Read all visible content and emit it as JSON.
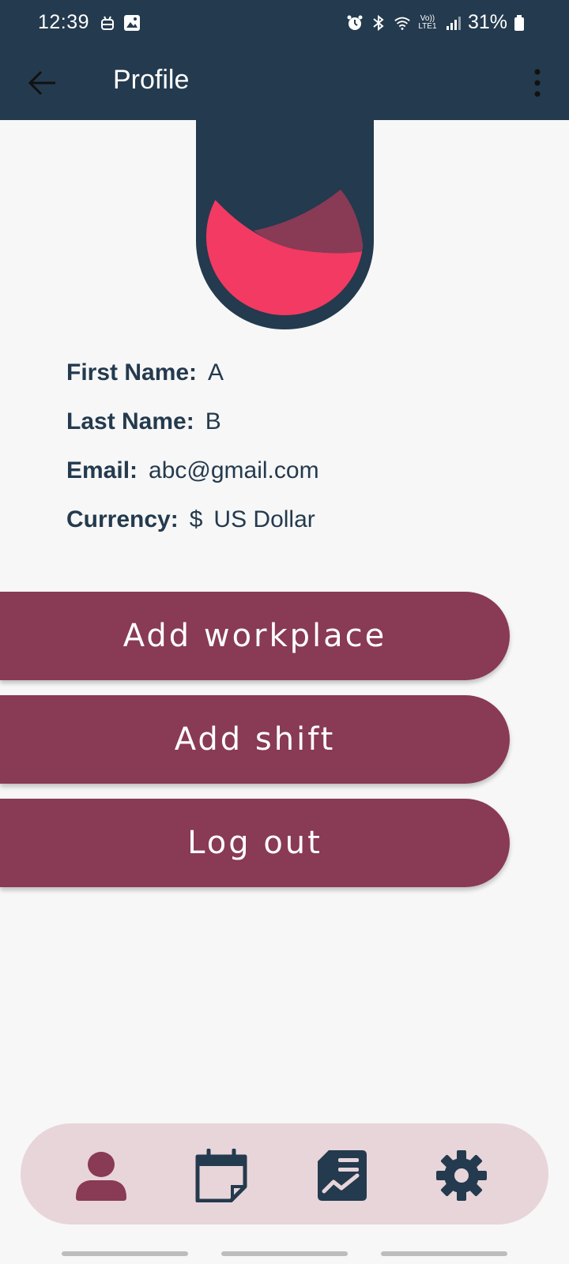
{
  "status_bar": {
    "time": "12:39",
    "battery": "31%",
    "left_icons": [
      "android-robot-icon",
      "image-notification-icon"
    ],
    "right_icons": [
      "alarm-icon",
      "bluetooth-icon",
      "wifi-icon",
      "volte-icon",
      "signal-icon",
      "battery-icon"
    ],
    "volte_label": "Vo)) LTE1"
  },
  "app_bar": {
    "title": "Profile",
    "back_icon": "arrow-left-icon",
    "menu_icon": "more-vertical-icon"
  },
  "profile": {
    "first_name_label": "First Name:",
    "first_name": "A",
    "last_name_label": "Last Name:",
    "last_name": "B",
    "email_label": "Email:",
    "email": "abc@gmail.com",
    "currency_label": "Currency:",
    "currency_symbol": "$",
    "currency_name": "US Dollar"
  },
  "actions": {
    "add_workplace": "Add workplace",
    "add_shift": "Add shift",
    "log_out": "Log out"
  },
  "bottom_nav": [
    {
      "icon": "user-icon",
      "active": true
    },
    {
      "icon": "calendar-icon",
      "active": false
    },
    {
      "icon": "report-chart-icon",
      "active": false
    },
    {
      "icon": "gear-icon",
      "active": false
    }
  ],
  "colors": {
    "primary_dark": "#243A4E",
    "accent_maroon": "#893A55",
    "accent_pink": "#F23A63",
    "nav_background": "#E8D5D9",
    "page_background": "#F7F7F7"
  }
}
